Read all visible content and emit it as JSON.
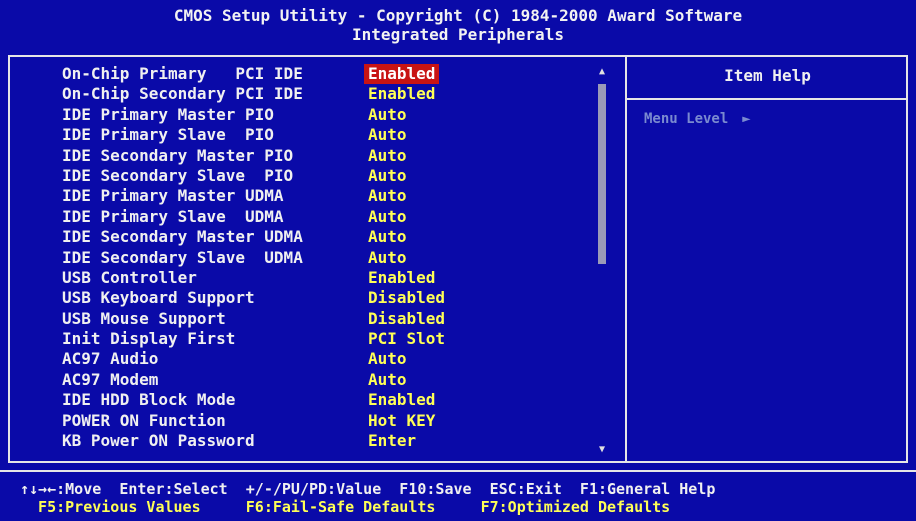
{
  "header": {
    "line1": "CMOS Setup Utility - Copyright (C) 1984-2000 Award Software",
    "line2": "Integrated Peripherals"
  },
  "settings": [
    {
      "label": "On-Chip Primary   PCI IDE",
      "value": "Enabled",
      "selected": true
    },
    {
      "label": "On-Chip Secondary PCI IDE",
      "value": "Enabled"
    },
    {
      "label": "IDE Primary Master PIO",
      "value": "Auto"
    },
    {
      "label": "IDE Primary Slave  PIO",
      "value": "Auto"
    },
    {
      "label": "IDE Secondary Master PIO",
      "value": "Auto"
    },
    {
      "label": "IDE Secondary Slave  PIO",
      "value": "Auto"
    },
    {
      "label": "IDE Primary Master UDMA",
      "value": "Auto"
    },
    {
      "label": "IDE Primary Slave  UDMA",
      "value": "Auto"
    },
    {
      "label": "IDE Secondary Master UDMA",
      "value": "Auto"
    },
    {
      "label": "IDE Secondary Slave  UDMA",
      "value": "Auto"
    },
    {
      "label": "USB Controller",
      "value": "Enabled"
    },
    {
      "label": "USB Keyboard Support",
      "value": "Disabled"
    },
    {
      "label": "USB Mouse Support",
      "value": "Disabled"
    },
    {
      "label": "Init Display First",
      "value": "PCI Slot"
    },
    {
      "label": "AC97 Audio",
      "value": "Auto"
    },
    {
      "label": "AC97 Modem",
      "value": "Auto"
    },
    {
      "label": "IDE HDD Block Mode",
      "value": "Enabled"
    },
    {
      "label": "POWER ON Function",
      "value": "Hot KEY"
    },
    {
      "label": "KB Power ON Password",
      "value": "Enter"
    }
  ],
  "help": {
    "title": "Item Help",
    "menu_level_label": "Menu Level",
    "menu_level_arrow": "►"
  },
  "footer": {
    "line1": "↑↓→←:Move  Enter:Select  +/-/PU/PD:Value  F10:Save  ESC:Exit  F1:General Help",
    "line2": "  F5:Previous Values     F6:Fail-Safe Defaults     F7:Optimized Defaults"
  },
  "scrollbar": {
    "up": "▲",
    "down": "▼"
  },
  "colors": {
    "background": "#0a0aa8",
    "label": "#f0f0f0",
    "value": "#ffff55",
    "selected_bg": "#c81414"
  }
}
